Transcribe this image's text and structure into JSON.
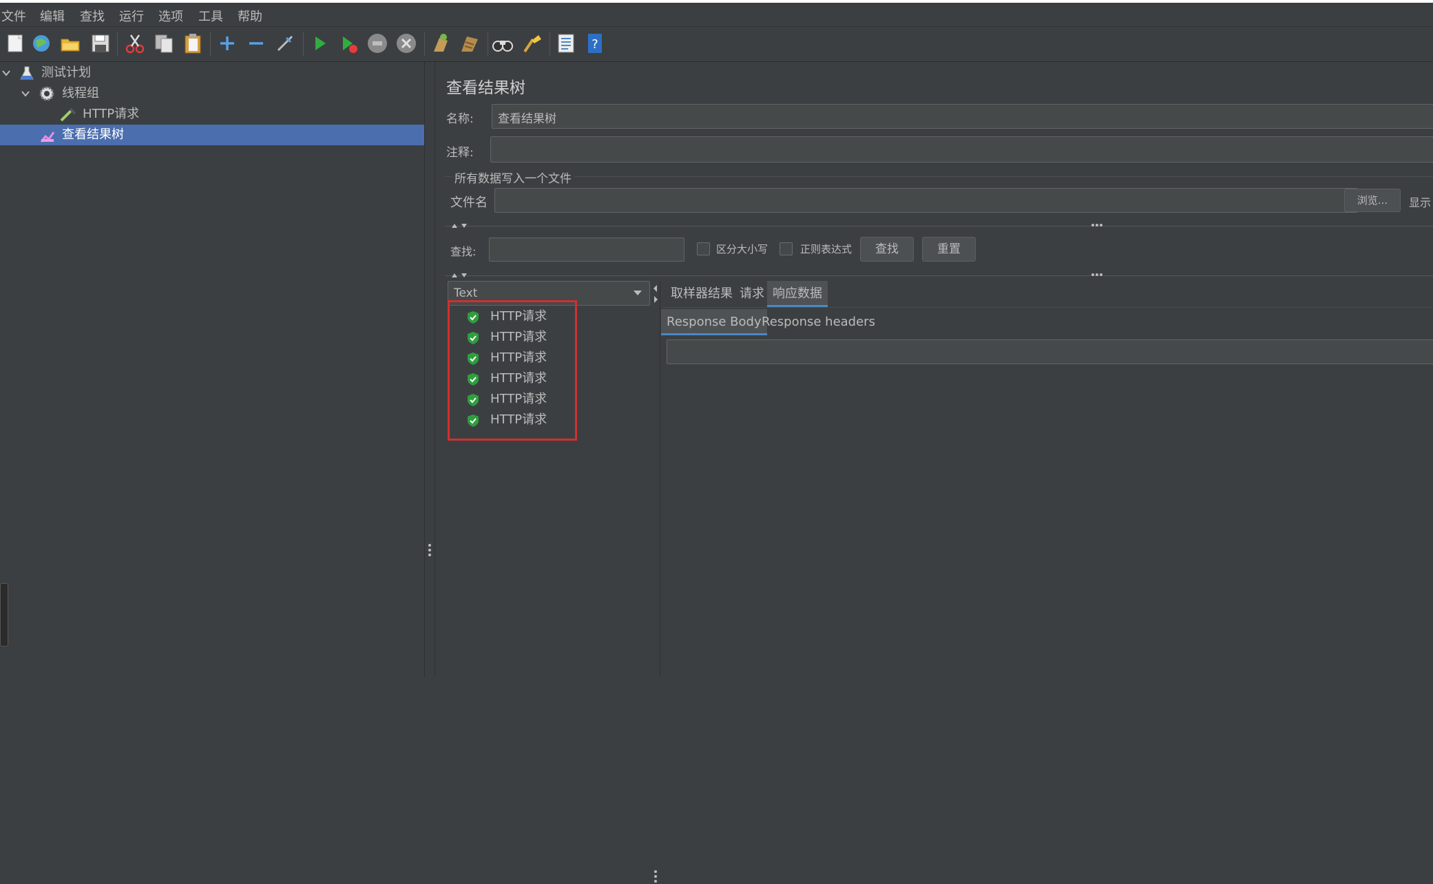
{
  "menu": [
    "文件",
    "编辑",
    "查找",
    "运行",
    "选项",
    "工具",
    "帮助"
  ],
  "toolbar_icons": [
    "new-icon",
    "templates-icon",
    "open-icon",
    "save-icon",
    "cut-icon",
    "copy-icon",
    "paste-icon",
    "add-icon",
    "remove-icon",
    "toggle-icon",
    "start-icon",
    "start-no-pause-icon",
    "stop-icon",
    "shutdown-icon",
    "clear-icon",
    "clear-all-icon",
    "search-icon",
    "reset-search-icon",
    "function-helper-icon",
    "help-icon"
  ],
  "tree": {
    "test_plan": "测试计划",
    "thread_group": "线程组",
    "http_request": "HTTP请求",
    "result_tree": "查看结果树"
  },
  "panel": {
    "title": "查看结果树",
    "name_label": "名称:",
    "name_value": "查看结果树",
    "comment_label": "注释:",
    "comment_value": "",
    "file_group_title": "所有数据写入一个文件",
    "file_label": "文件名",
    "file_value": "",
    "browse_button": "浏览...",
    "display_label": "显示"
  },
  "search": {
    "label": "查找:",
    "value": "",
    "case_sensitive": "区分大小写",
    "regex": "正则表达式",
    "find_button": "查找",
    "reset_button": "重置"
  },
  "renderer_select": "Text",
  "results": [
    "HTTP请求",
    "HTTP请求",
    "HTTP请求",
    "HTTP请求",
    "HTTP请求",
    "HTTP请求"
  ],
  "tabs": [
    "取样器结果",
    "请求",
    "响应数据"
  ],
  "active_tab": "响应数据",
  "subtabs": [
    "Response Body",
    "Response headers"
  ],
  "active_subtab": "Response Body",
  "colors": {
    "background": "#3c3f41",
    "selection": "#4b6eaf",
    "highlight_box": "#d32f2f",
    "success_icon": "#2e9e3e"
  }
}
